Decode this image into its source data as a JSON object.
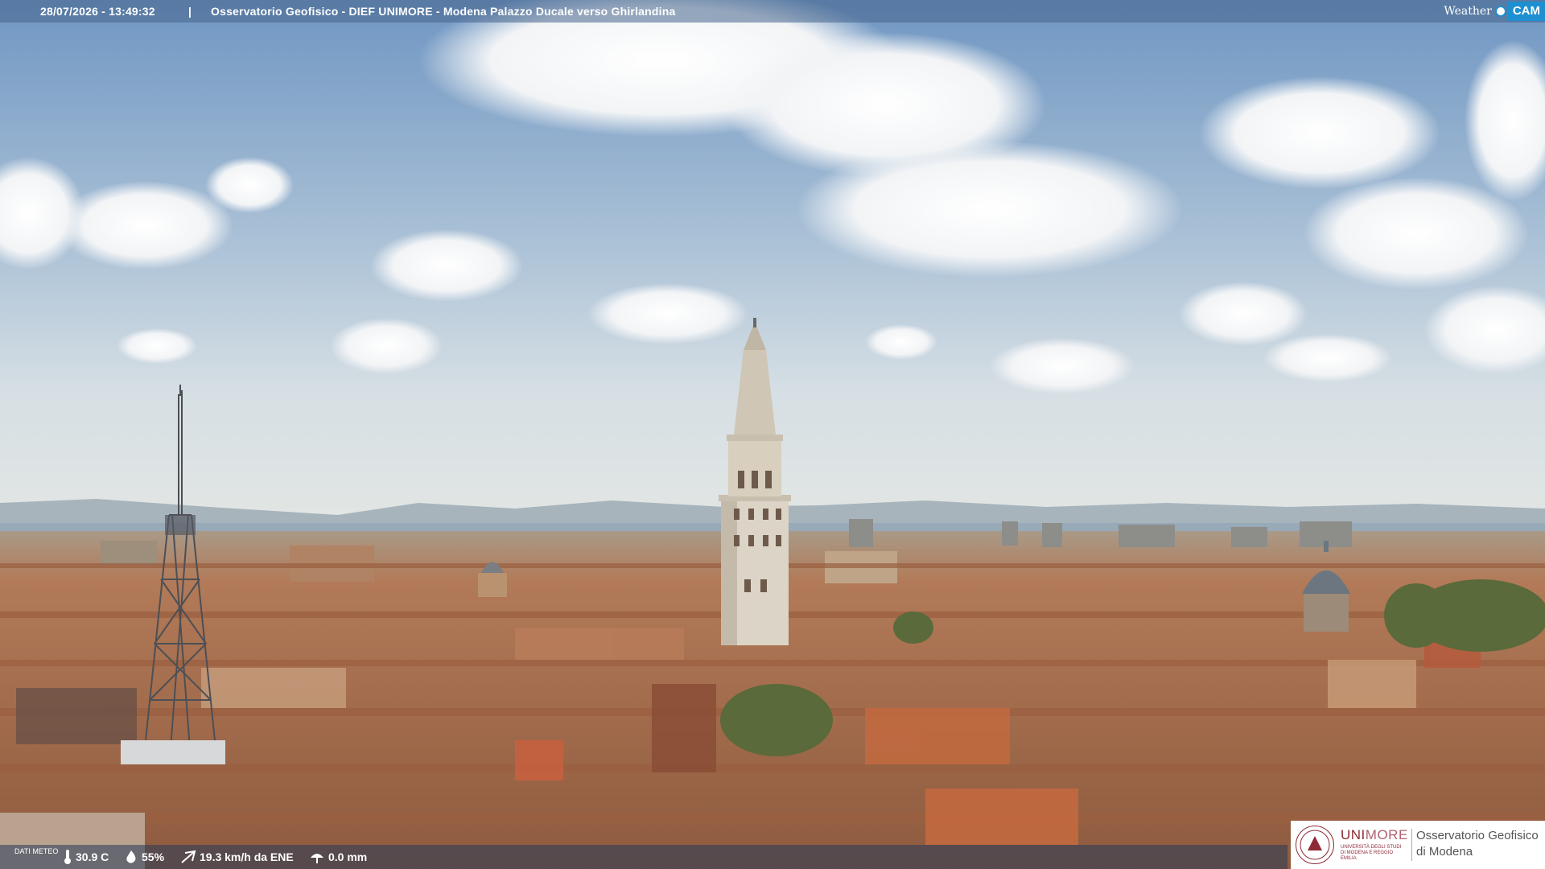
{
  "header": {
    "timestamp": "28/07/2026 - 13:49:32",
    "separator": "|",
    "title": "Osservatorio Geofisico - DIEF UNIMORE - Modena Palazzo Ducale verso Ghirlandina",
    "brand_weather": "Weather",
    "brand_cam": "CAM"
  },
  "weather": {
    "label": "DATI METEO",
    "temperature": "30.9 C",
    "humidity": "55%",
    "wind": "19.3 km/h da ENE",
    "rain": "0.0 mm"
  },
  "logo": {
    "uni": "UNI",
    "more": "MORE",
    "uni_sub": "UNIVERSITÀ DEGLI STUDI DI MODENA E REGGIO EMILIA",
    "observatory_line1": "Osservatorio Geofisico",
    "observatory_line2": "di Modena"
  },
  "colors": {
    "sky_top": "#7fa3c9",
    "sky_bottom": "#dfe6ea",
    "roofs": "#a86a4a",
    "brand_blue": "#1e8fd0",
    "unimore_red": "#8d2a35"
  },
  "icons": [
    "thermometer-icon",
    "humidity-icon",
    "wind-icon",
    "rain-icon"
  ]
}
